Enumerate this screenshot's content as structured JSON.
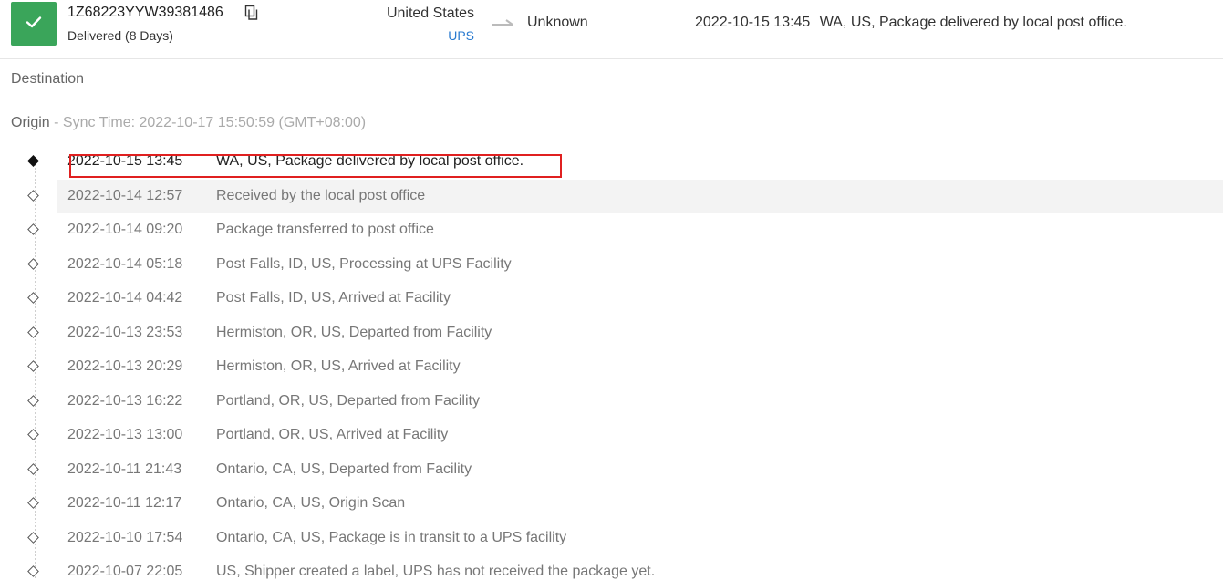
{
  "header": {
    "status_icon": "check-icon",
    "status_color": "#3aa55a",
    "tracking_number": "1Z68223YYW39381486",
    "copy_icon": "copy-icon",
    "status": "Delivered (8 Days)",
    "origin_country": "United States",
    "carrier": "UPS",
    "carrier_color": "#2a7bd0",
    "destination_country": "Unknown",
    "latest_time": "2022-10-15 13:45",
    "latest_desc": "WA, US, Package delivered by local post office."
  },
  "destination": {
    "label": "Destination"
  },
  "origin": {
    "label": "Origin",
    "separator": " - ",
    "sync_time": "Sync Time: 2022-10-17 15:50:59 (GMT+08:00)"
  },
  "events": [
    {
      "time": "2022-10-15 13:45",
      "desc": "WA, US, Package delivered by local post office."
    },
    {
      "time": "2022-10-14 12:57",
      "desc": "Received by the local post office"
    },
    {
      "time": "2022-10-14 09:20",
      "desc": "Package transferred to post office"
    },
    {
      "time": "2022-10-14 05:18",
      "desc": "Post Falls, ID, US, Processing at UPS Facility"
    },
    {
      "time": "2022-10-14 04:42",
      "desc": "Post Falls, ID, US, Arrived at Facility"
    },
    {
      "time": "2022-10-13 23:53",
      "desc": "Hermiston, OR, US, Departed from Facility"
    },
    {
      "time": "2022-10-13 20:29",
      "desc": "Hermiston, OR, US, Arrived at Facility"
    },
    {
      "time": "2022-10-13 16:22",
      "desc": "Portland, OR, US, Departed from Facility"
    },
    {
      "time": "2022-10-13 13:00",
      "desc": "Portland, OR, US, Arrived at Facility"
    },
    {
      "time": "2022-10-11 21:43",
      "desc": "Ontario, CA, US, Departed from Facility"
    },
    {
      "time": "2022-10-11 12:17",
      "desc": "Ontario, CA, US, Origin Scan"
    },
    {
      "time": "2022-10-10 17:54",
      "desc": "Ontario, CA, US, Package is in transit to a UPS facility"
    },
    {
      "time": "2022-10-07 22:05",
      "desc": "US, Shipper created a label, UPS has not received the package yet."
    }
  ],
  "highlight_color": "#e02020"
}
